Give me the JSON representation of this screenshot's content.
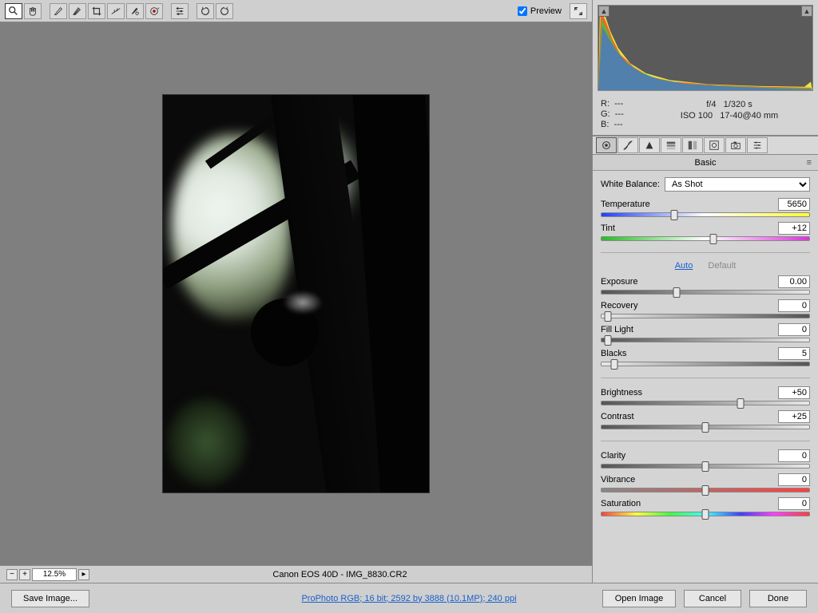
{
  "toolbar": {
    "preview_label": "Preview",
    "preview_checked": true
  },
  "zoom": {
    "value": "12.5%"
  },
  "status": {
    "camera": "Canon EOS 40D",
    "separator": "  -  ",
    "filename": "IMG_8830.CR2"
  },
  "exif": {
    "r_label": "R:",
    "g_label": "G:",
    "b_label": "B:",
    "r_val": "---",
    "g_val": "---",
    "b_val": "---",
    "aperture": "f/4",
    "shutter": "1/320 s",
    "iso": "ISO 100",
    "lens": "17-40@40 mm"
  },
  "panel": {
    "title": "Basic",
    "wb_label": "White Balance:",
    "wb_value": "As Shot",
    "auto_label": "Auto",
    "default_label": "Default",
    "sliders": {
      "temperature": {
        "label": "Temperature",
        "value": "5650"
      },
      "tint": {
        "label": "Tint",
        "value": "+12"
      },
      "exposure": {
        "label": "Exposure",
        "value": "0.00"
      },
      "recovery": {
        "label": "Recovery",
        "value": "0"
      },
      "filllight": {
        "label": "Fill Light",
        "value": "0"
      },
      "blacks": {
        "label": "Blacks",
        "value": "5"
      },
      "brightness": {
        "label": "Brightness",
        "value": "+50"
      },
      "contrast": {
        "label": "Contrast",
        "value": "+25"
      },
      "clarity": {
        "label": "Clarity",
        "value": "0"
      },
      "vibrance": {
        "label": "Vibrance",
        "value": "0"
      },
      "saturation": {
        "label": "Saturation",
        "value": "0"
      }
    }
  },
  "footer": {
    "save_image": "Save Image...",
    "profile_link": "ProPhoto RGB; 16 bit; 2592 by 3888 (10.1MP); 240 ppi",
    "open_image": "Open Image",
    "cancel": "Cancel",
    "done": "Done"
  }
}
